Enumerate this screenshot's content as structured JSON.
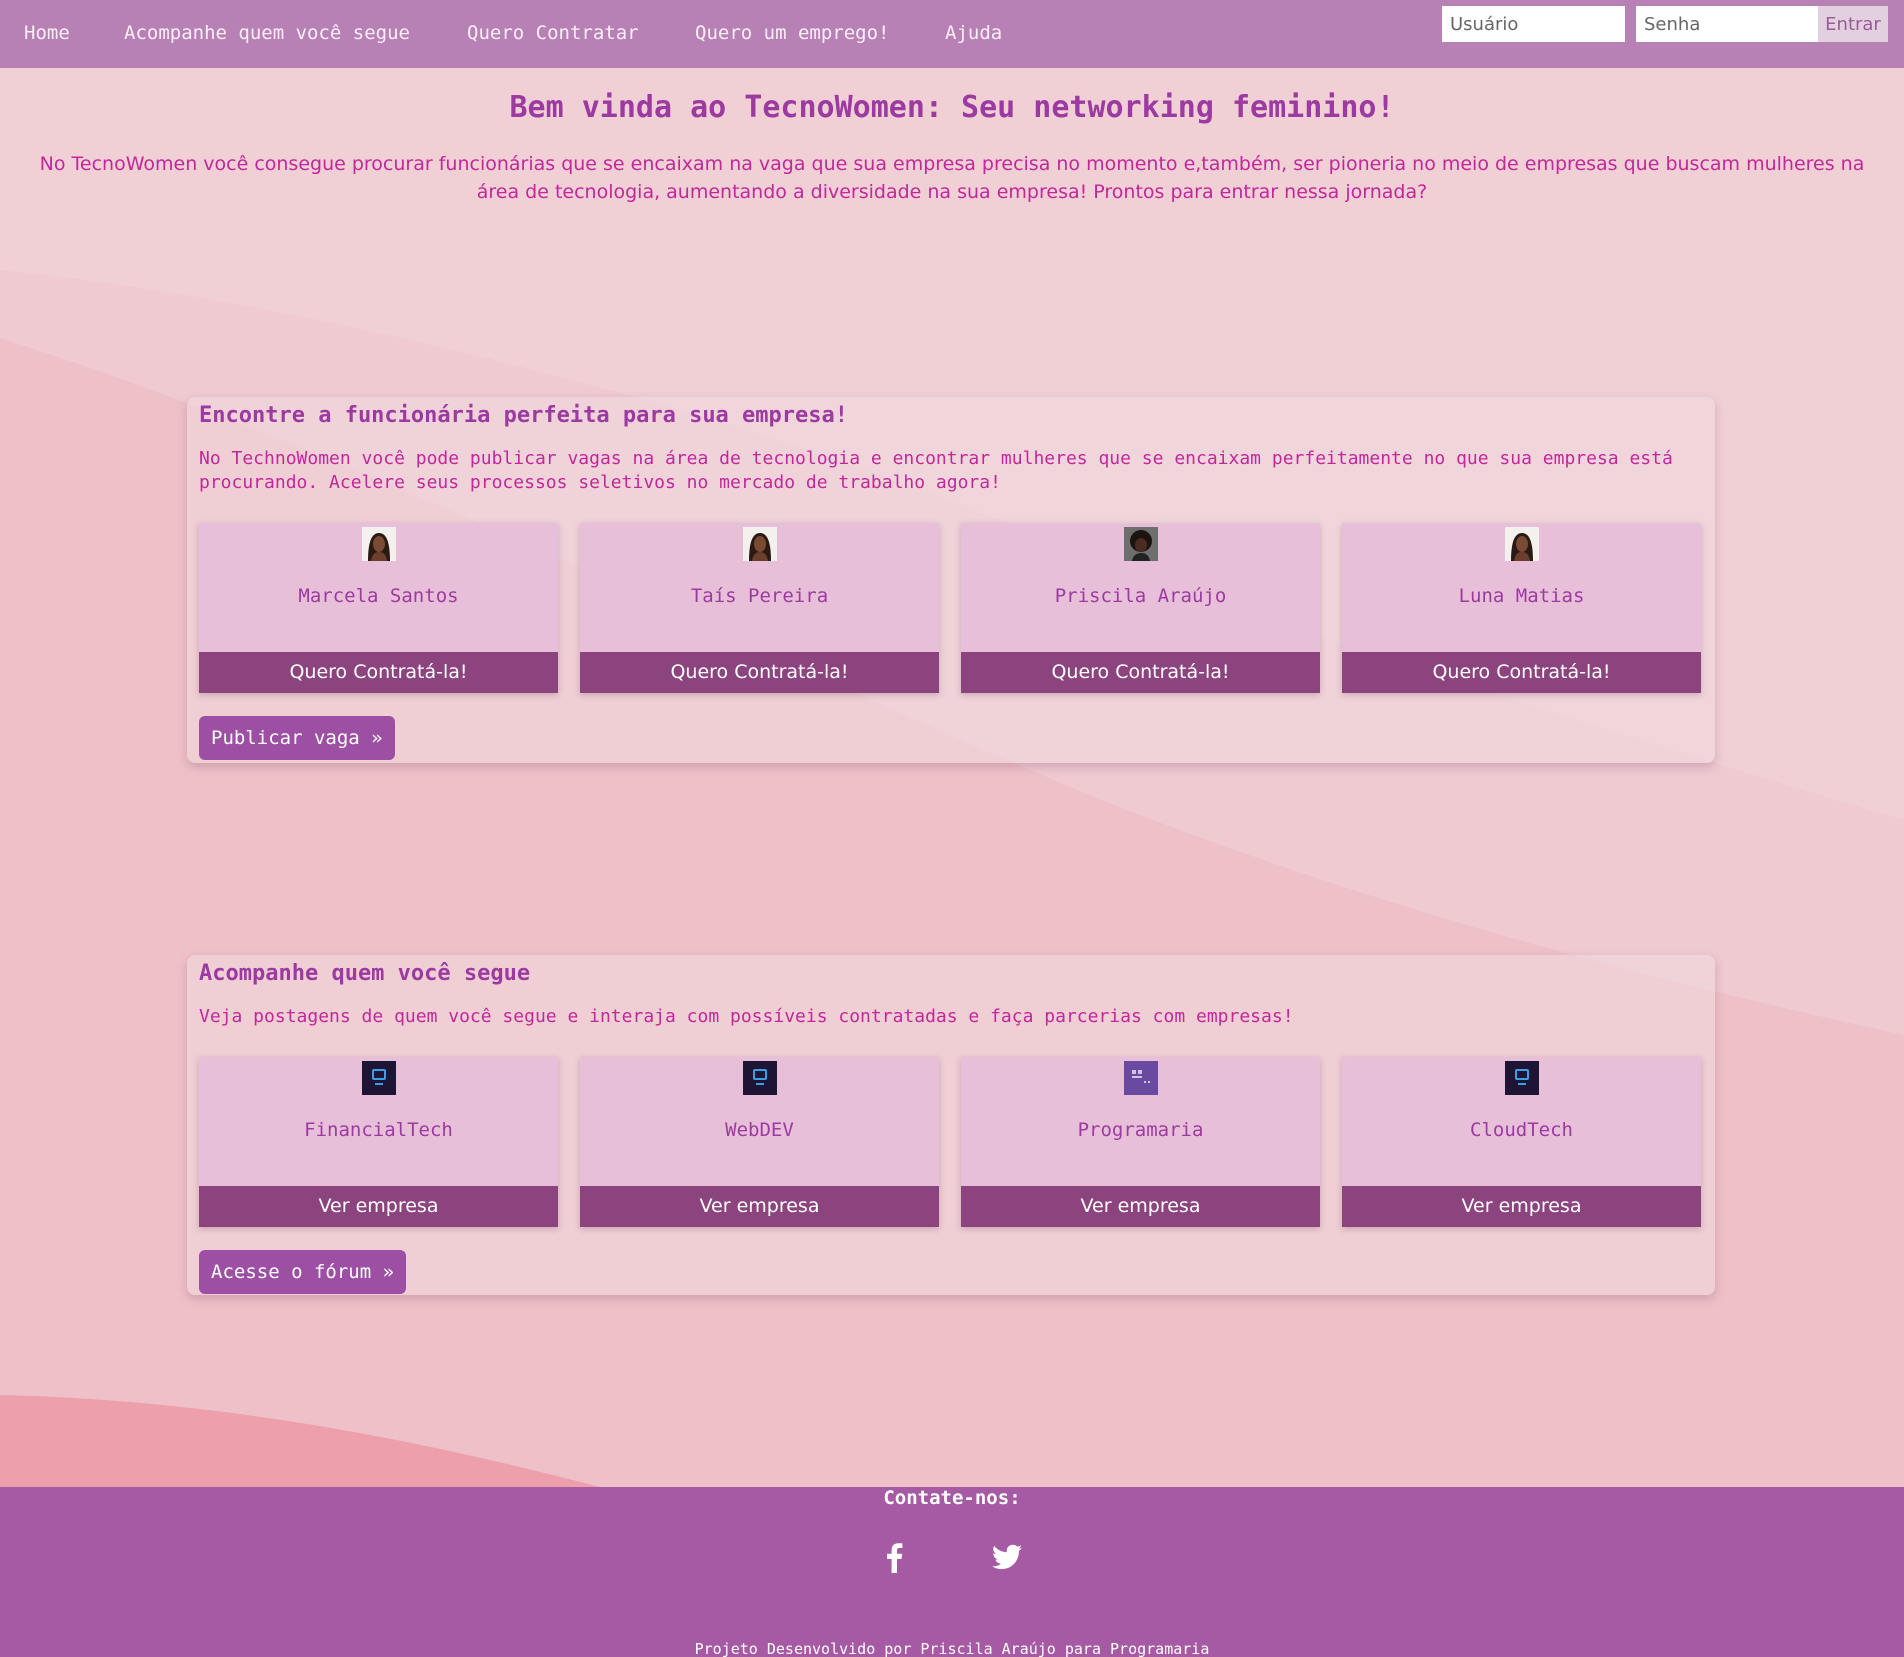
{
  "nav": {
    "links": [
      "Home",
      "Acompanhe quem você segue",
      "Quero Contratar",
      "Quero um emprego!",
      "Ajuda"
    ],
    "username_placeholder": "Usuário",
    "password_placeholder": "Senha",
    "login_label": "Entrar"
  },
  "hero": {
    "title": "Bem vinda ao TecnoWomen: Seu networking feminino!",
    "text": "No TecnoWomen você consegue procurar funcionárias que se encaixam na vaga que sua empresa precisa no momento e,também, ser pioneria no meio de empresas que buscam mulheres na área de tecnologia, aumentando a diversidade na sua empresa! Prontos para entrar nessa jornada?"
  },
  "hire_section": {
    "title": "Encontre a funcionária perfeita para sua empresa!",
    "text": "No TechnoWomen você pode publicar vagas na área de tecnologia e encontrar mulheres que se encaixam perfeitamente no que sua empresa está procurando. Acelere seus processos seletivos no mercado de trabalho agora!",
    "cards": [
      {
        "name": "Marcela Santos",
        "button": "Quero Contratá-la!"
      },
      {
        "name": "Taís Pereira",
        "button": "Quero Contratá-la!"
      },
      {
        "name": "Priscila Araújo",
        "button": "Quero Contratá-la!"
      },
      {
        "name": "Luna Matias",
        "button": "Quero Contratá-la!"
      }
    ],
    "cta": "Publicar vaga »"
  },
  "follow_section": {
    "title": "Acompanhe quem você segue",
    "text": "Veja postagens de quem você segue e interaja com possíveis contratadas e faça parcerias com empresas!",
    "cards": [
      {
        "name": "FinancialTech",
        "button": "Ver empresa"
      },
      {
        "name": "WebDEV",
        "button": "Ver empresa"
      },
      {
        "name": "Programaria",
        "button": "Ver empresa"
      },
      {
        "name": "CloudTech",
        "button": "Ver empresa"
      }
    ],
    "cta": "Acesse o fórum »"
  },
  "footer": {
    "heading": "Contate-nos:",
    "social_icons": [
      "facebook-icon",
      "twitter-icon"
    ],
    "credit": "Projeto Desenvolvido por Priscila Araújo para Programaria"
  },
  "colors": {
    "nav_background": "#b781b6",
    "page_background": "#f0cfd5",
    "accent": "#9c3aa1",
    "text_magenta": "#c2279b",
    "card_background": "#e8bfd8",
    "card_button": "#8c447f",
    "footer_background": "#a75aa4"
  }
}
